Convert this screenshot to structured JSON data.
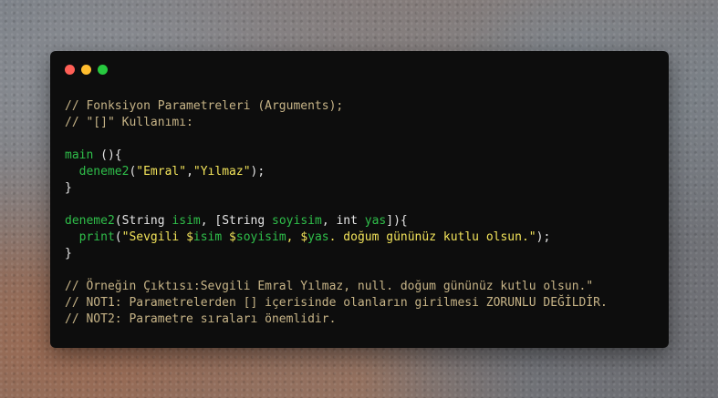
{
  "window": {
    "controls": {
      "close_color": "#ff5f56",
      "minimize_color": "#ffbd2e",
      "maximize_color": "#27c93f"
    }
  },
  "code": {
    "line1": "// Fonksiyon Parametreleri (Arguments);",
    "line2": "// \"[]\" Kullanımı:",
    "main_name": "main",
    "main_rest": " (){",
    "deneme_call_name": "deneme2",
    "deneme_call_open": "(",
    "arg1": "\"Emral\"",
    "comma": ",",
    "arg2": "\"Yılmaz\"",
    "deneme_call_close": ");",
    "close_brace": "}",
    "def_name": "deneme2",
    "def_p1_type": "(String ",
    "def_p1_name": "isim",
    "def_sep1": ", [String ",
    "def_p2_name": "soyisim",
    "def_sep2": ", int ",
    "def_p3_name": "yas",
    "def_end": "]){",
    "print_name": "print",
    "print_open": "(",
    "print_str1": "\"Sevgili $",
    "print_v1": "isim",
    "print_str2": " $",
    "print_v2": "soyisim",
    "print_str3": ", $",
    "print_v3": "yas",
    "print_str4": ". doğum gününüz kutlu olsun.\"",
    "print_close": ");",
    "close_brace2": "}",
    "out1": "// Örneğin Çıktısı:Sevgili Emral Yılmaz, null. doğum gününüz kutlu olsun.\"",
    "out2": "// NOT1: Parametrelerden [] içerisinde olanların girilmesi ZORUNLU DEĞİLDİR.",
    "out3": "// NOT2: Parametre sıraları önemlidir."
  }
}
